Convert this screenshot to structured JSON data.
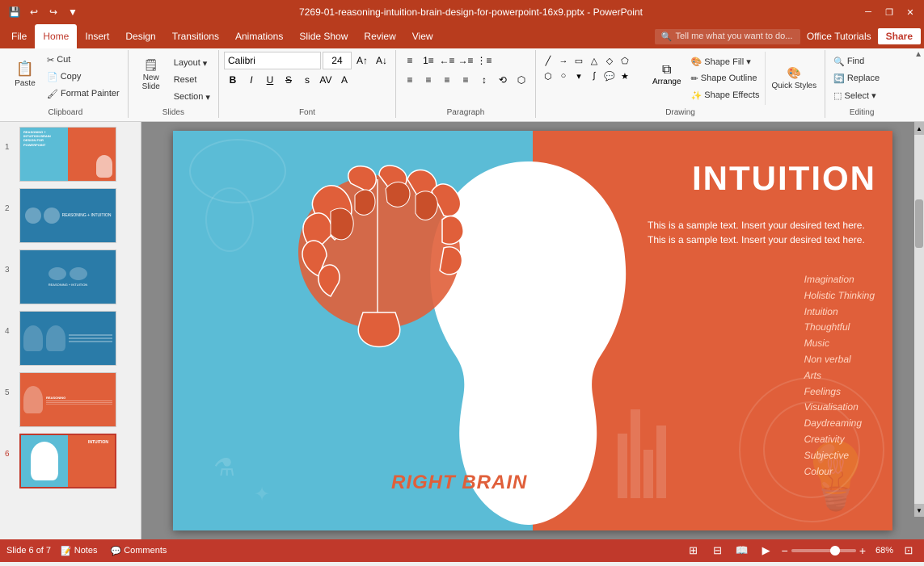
{
  "titlebar": {
    "title": "7269-01-reasoning-intuition-brain-design-for-powerpoint-16x9.pptx - PowerPoint",
    "quickaccess": [
      "💾",
      "↩",
      "↪",
      "⚙",
      "▼"
    ]
  },
  "menubar": {
    "items": [
      "File",
      "Home",
      "Insert",
      "Design",
      "Transitions",
      "Animations",
      "Slide Show",
      "Review",
      "View"
    ],
    "active": "Home",
    "tellme": "Tell me what you want to do...",
    "officetuts": "Office Tutorials",
    "share": "Share"
  },
  "ribbon": {
    "groups": {
      "clipboard": {
        "label": "Clipboard",
        "paste": "Paste",
        "cut": "Cut",
        "copy": "Copy",
        "format_painter": "Format Painter"
      },
      "slides": {
        "label": "Slides",
        "new_slide": "New Slide",
        "layout": "Layout",
        "reset": "Reset",
        "section": "Section"
      },
      "font": {
        "label": "Font",
        "font_name": "Calibri",
        "font_size": "24",
        "bold": "B",
        "italic": "I",
        "underline": "U",
        "strikethrough": "S",
        "shadow": "s"
      },
      "paragraph": {
        "label": "Paragraph"
      },
      "drawing": {
        "label": "Drawing",
        "arrange": "Arrange",
        "quick_styles": "Quick Styles",
        "shape_fill": "Shape Fill ▾",
        "shape_outline": "Shape Outline",
        "shape_effects": "Shape Effects"
      },
      "editing": {
        "label": "Editing",
        "find": "Find",
        "replace": "Replace",
        "select": "Select ▾"
      }
    }
  },
  "slides": [
    {
      "num": "1",
      "active": false
    },
    {
      "num": "2",
      "active": false
    },
    {
      "num": "3",
      "active": false
    },
    {
      "num": "4",
      "active": false
    },
    {
      "num": "5",
      "active": false
    },
    {
      "num": "6",
      "active": true
    }
  ],
  "slide6": {
    "title": "INTUITION",
    "desc": "This is a sample text. Insert your desired text  here. This is a sample text. Insert your desired text here.",
    "right_brain_label": "RIGHT BRAIN",
    "list_items": [
      "Imagination",
      "Holistic Thinking",
      "Intuition",
      "Thoughtful",
      "Music",
      "Non verbal",
      "Arts",
      "Feelings",
      "Visualisation",
      "Daydreaming",
      "Creativity",
      "Subjective",
      "Colour"
    ]
  },
  "statusbar": {
    "slide_info": "Slide 6 of 7",
    "notes": "Notes",
    "comments": "Comments",
    "zoom": "68%"
  },
  "colors": {
    "accent_red": "#c0392b",
    "slide_blue": "#5bbcd6",
    "slide_orange": "#e05f3a",
    "ribbon_bg": "#f8f8f8"
  }
}
